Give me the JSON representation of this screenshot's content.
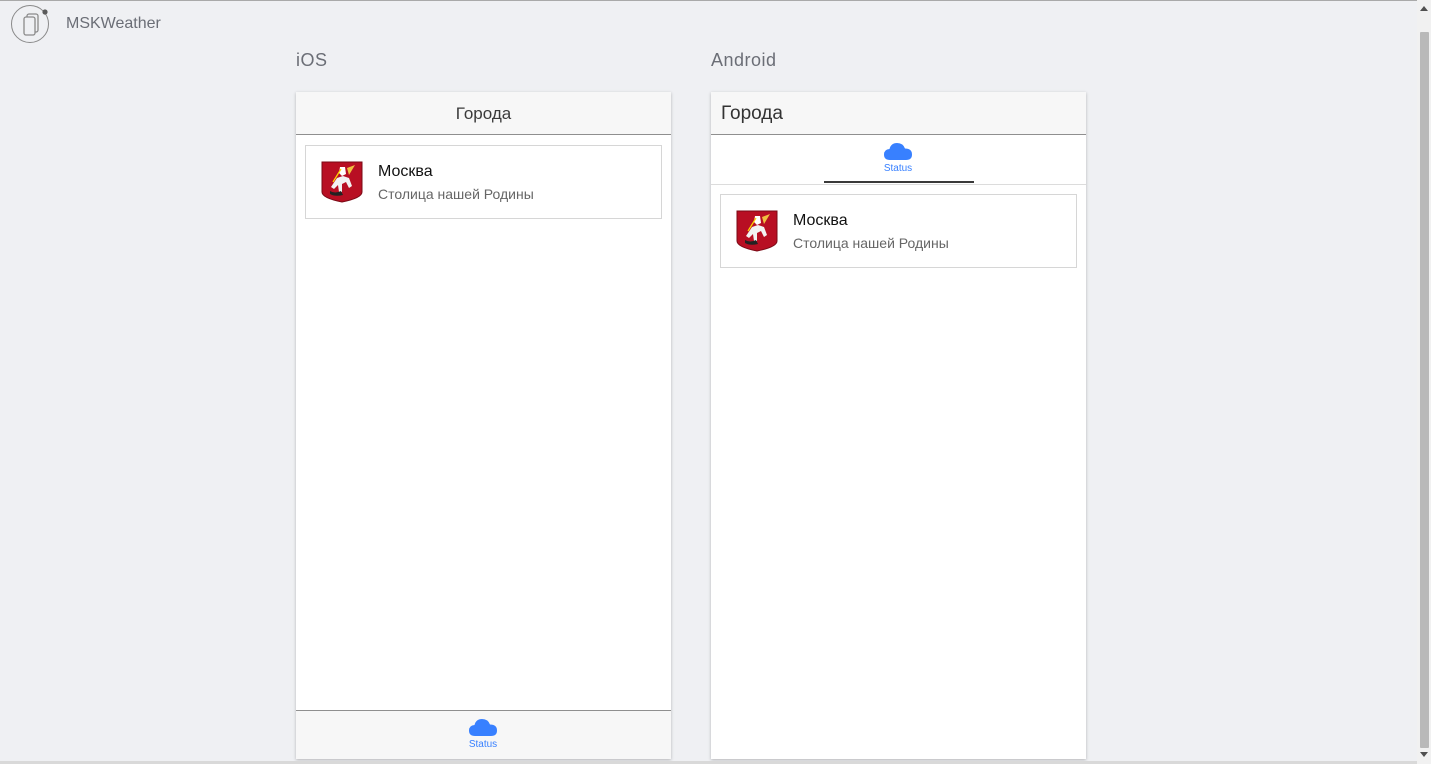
{
  "app": {
    "title": "MSKWeather"
  },
  "platforms": {
    "ios_label": "iOS",
    "android_label": "Android"
  },
  "ios": {
    "nav_title": "Города",
    "items": [
      {
        "name": "Москва",
        "description": "Столица нашей Родины",
        "icon": "moscow-coat-of-arms-icon"
      }
    ],
    "tabs": [
      {
        "label": "Status",
        "icon": "cloud-icon"
      }
    ]
  },
  "android": {
    "nav_title": "Города",
    "items": [
      {
        "name": "Москва",
        "description": "Столица нашей Родины",
        "icon": "moscow-coat-of-arms-icon"
      }
    ],
    "tabs": [
      {
        "label": "Status",
        "icon": "cloud-icon"
      }
    ]
  },
  "colors": {
    "accent": "#3880ff",
    "background": "#eff0f3",
    "coat_red": "#c8102e"
  }
}
